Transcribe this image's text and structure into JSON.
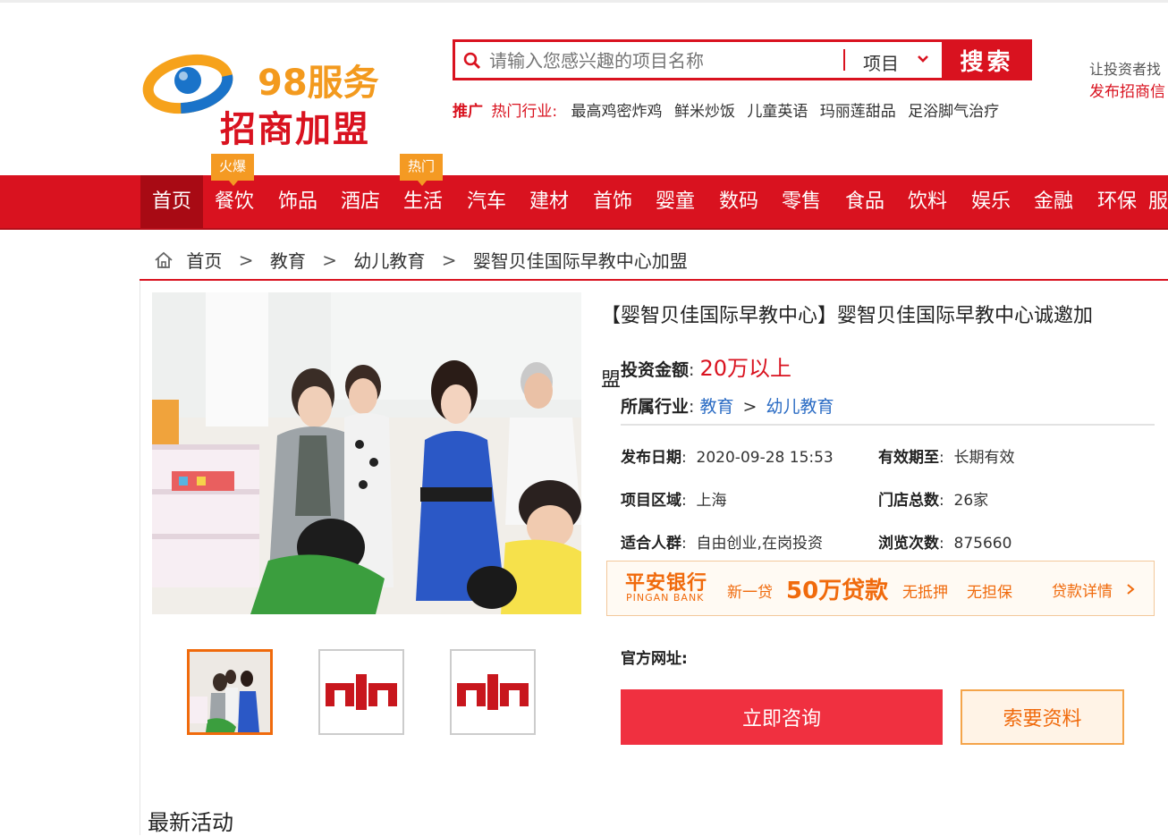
{
  "header": {
    "logo_text_top": "98服务",
    "logo_text_bottom": "招商加盟",
    "search_placeholder": "请输入您感兴趣的项目名称",
    "search_type": "项目",
    "search_button": "搜索",
    "promo_tag": "推广",
    "promo_label": "热门行业:",
    "promo_items": [
      "最高鸡密炸鸡",
      "鲜米炒饭",
      "儿童英语",
      "玛丽莲甜品",
      "足浴脚气治疗"
    ],
    "right_text": "让投资者找",
    "right_link": "发布招商信"
  },
  "nav": {
    "items": [
      "首页",
      "餐饮",
      "饰品",
      "酒店",
      "生活",
      "汽车",
      "建材",
      "首饰",
      "婴童",
      "数码",
      "零售",
      "食品",
      "饮料",
      "娱乐",
      "金融",
      "环保",
      "服"
    ],
    "badges": [
      "火爆",
      "热门"
    ]
  },
  "breadcrumb": {
    "items": [
      "首页",
      "教育",
      "幼儿教育",
      "婴智贝佳国际早教中心加盟"
    ]
  },
  "project": {
    "title_line1": "【婴智贝佳国际早教中心】婴智贝佳国际早教中心诚邀加",
    "title_line2": "盟",
    "invest_label": "投资金额",
    "invest_value": "20万以上",
    "industry_label": "所属行业",
    "industry_main": "教育",
    "industry_sub": "幼儿教育",
    "meta": {
      "publish_label": "发布日期",
      "publish_value": "2020-09-28 15:53",
      "valid_label": "有效期至",
      "valid_value": "长期有效",
      "region_label": "项目区域",
      "region_value": "上海",
      "stores_label": "门店总数",
      "stores_value": "26家",
      "crowd_label": "适合人群",
      "crowd_value": "自由创业,在岗投资",
      "views_label": "浏览次数",
      "views_value": "875660"
    },
    "website_label": "官方网址:",
    "consult_button": "立即咨询",
    "info_button": "索要资料"
  },
  "ad": {
    "bank_cn": "平安银行",
    "bank_en": "PINGAN BANK",
    "text1": "新一贷",
    "text2": "50万贷款",
    "text3": "无抵押",
    "text4": "无担保",
    "link": "贷款详情"
  },
  "section": {
    "latest": "最新活动"
  },
  "colors": {
    "brand_red": "#d9121f",
    "accent_orange": "#f06a0c",
    "link_blue": "#2b6cc4"
  }
}
